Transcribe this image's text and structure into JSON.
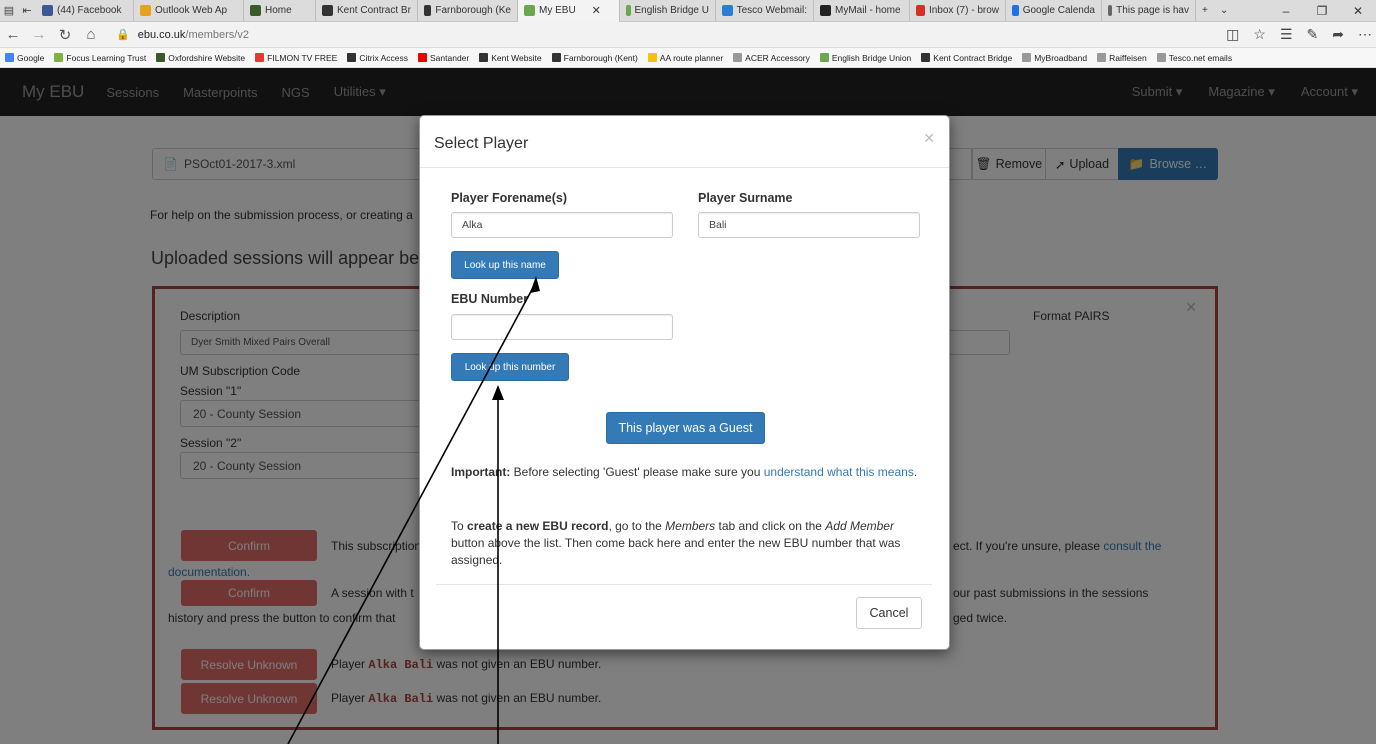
{
  "browser": {
    "tabs": [
      {
        "label": "(44) Facebook",
        "color": "#3b5998"
      },
      {
        "label": "Outlook Web Ap",
        "color": "#e8a11c"
      },
      {
        "label": "Home",
        "color": "#3a5a2a"
      },
      {
        "label": "Kent Contract Br",
        "color": "#333333"
      },
      {
        "label": "Farnborough (Ke",
        "color": "#333333"
      },
      {
        "label": "My EBU",
        "color": "#6aa84f",
        "active": true
      },
      {
        "label": "English Bridge U",
        "color": "#6aa84f"
      },
      {
        "label": "Tesco Webmail:",
        "color": "#2a7fd4"
      },
      {
        "label": "MyMail - home",
        "color": "#222222"
      },
      {
        "label": "Inbox (7) - brow",
        "color": "#d93025"
      },
      {
        "label": "Google Calenda",
        "color": "#1a73e8"
      },
      {
        "label": "This page is hav",
        "color": "#666666"
      }
    ],
    "url_host": "ebu.co.uk",
    "url_path": "/members/v2",
    "favorites": [
      {
        "label": "Google",
        "color": "#4285f4"
      },
      {
        "label": "Focus Learning Trust",
        "color": "#7cb342"
      },
      {
        "label": "Oxfordshire Website",
        "color": "#3a5a2a"
      },
      {
        "label": "FILMON TV FREE",
        "color": "#e53935"
      },
      {
        "label": "Citrix Access",
        "color": "#333333"
      },
      {
        "label": "Santander",
        "color": "#ec0000"
      },
      {
        "label": "Kent Website",
        "color": "#333333"
      },
      {
        "label": "Farnborough (Kent)",
        "color": "#333333"
      },
      {
        "label": "AA route planner",
        "color": "#f5c400"
      },
      {
        "label": "ACER Accessory",
        "color": "#999999"
      },
      {
        "label": "English Bridge Union",
        "color": "#6aa84f"
      },
      {
        "label": "Kent Contract Bridge",
        "color": "#333333"
      },
      {
        "label": "MyBroadband",
        "color": "#999999"
      },
      {
        "label": "Raiffeisen",
        "color": "#999999"
      },
      {
        "label": "Tesco.net emails",
        "color": "#999999"
      }
    ]
  },
  "navbar": {
    "brand": "My EBU",
    "links": [
      "Sessions",
      "Masterpoints",
      "NGS",
      "Utilities ▾"
    ],
    "right_links": [
      "Submit ▾",
      "Magazine ▾",
      "Account ▾"
    ]
  },
  "upload": {
    "filename": "PSOct01-2017-3.xml",
    "remove_label": "Remove",
    "upload_label": "Upload",
    "browse_label": "Browse …",
    "help_text": "For help on the submission process, or creating a",
    "uploaded_heading": "Uploaded sessions will appear below t"
  },
  "panel": {
    "description_label": "Description",
    "description_value": "Dyer Smith Mixed Pairs Overall",
    "format_label": "Format PAIRS",
    "um_label": "UM Subscription Code",
    "session1_label": "Session \"1\"",
    "session1_value": "20 - County Session",
    "session2_label": "Session \"2\"",
    "session2_value": "20 - County Session",
    "confirm_label": "Confirm",
    "confirm1_text": "This subscription",
    "confirm1_text_right": "ect. If you're unsure, please",
    "consult_link": "consult the",
    "documentation_link": "documentation.",
    "confirm2_text": "A session with t",
    "confirm2_text_right": "our past submissions in the sessions",
    "history_text": "history and press the button to confirm that",
    "history_text_right": "ged twice.",
    "resolve_label": "Resolve Unknown",
    "resolve_prefix": "Player",
    "resolve_player": "Alka Bali",
    "resolve_suffix": "was not given an EBU number."
  },
  "modal": {
    "title": "Select Player",
    "forename_label": "Player Forename(s)",
    "forename_value": "Alka",
    "surname_label": "Player Surname",
    "surname_value": "Bali",
    "lookup_name_label": "Look up this name",
    "ebu_label": "EBU Number",
    "ebu_value": "",
    "lookup_number_label": "Look up this number",
    "guest_label": "This player was a Guest",
    "important_bold": "Important:",
    "important_text": "Before selecting 'Guest' please make sure you",
    "important_link": "understand what this means",
    "create_pre": "To",
    "create_bold": "create a new EBU record",
    "create_mid1": ", go to the",
    "create_members": "Members",
    "create_mid2": "tab and click on the",
    "create_add": "Add Member",
    "create_rest": "button above the list. Then come back here and enter the new EBU number that was assigned.",
    "cancel_label": "Cancel"
  }
}
